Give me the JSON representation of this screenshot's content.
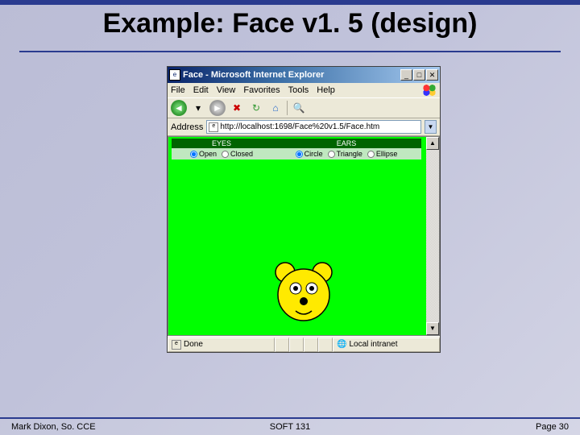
{
  "slide": {
    "title": "Example: Face v1. 5 (design)",
    "footer_left": "Mark Dixon, So. CCE",
    "footer_center": "SOFT 131",
    "footer_right": "Page 30"
  },
  "browser": {
    "window_title": "Face - Microsoft Internet Explorer",
    "menu": {
      "file": "File",
      "edit": "Edit",
      "view": "View",
      "favorites": "Favorites",
      "tools": "Tools",
      "help": "Help"
    },
    "address_label": "Address",
    "address_value": "http://localhost:1698/Face%20v1.5/Face.htm",
    "status_left": "Done",
    "status_right": "Local intranet"
  },
  "panel": {
    "eyes_header": "EYES",
    "eyes_open": "Open",
    "eyes_closed": "Closed",
    "ears_header": "EARS",
    "ears_circle": "Circle",
    "ears_triangle": "Triangle",
    "ears_ellipse": "Ellipse"
  }
}
